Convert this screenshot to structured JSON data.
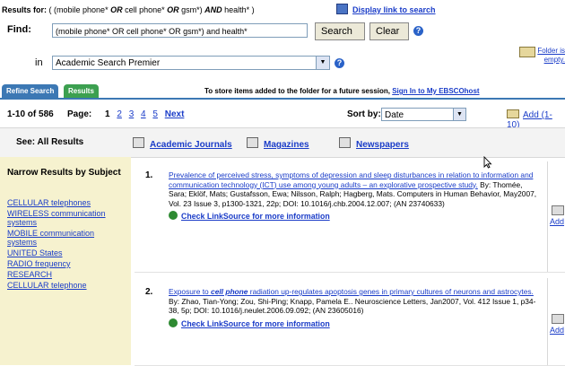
{
  "header": {
    "results_for_label": "Results for:",
    "results_for_query_a": "( (mobile phone* ",
    "results_for_op1": "OR",
    "results_for_query_b": " cell phone* ",
    "results_for_op2": "OR",
    "results_for_query_c": " gsm*) ",
    "results_for_op3": "AND",
    "results_for_query_d": " health* )",
    "display_link": "Display link to search"
  },
  "search": {
    "find_label": "Find:",
    "query_value": "(mobile phone* OR cell phone* OR gsm*) and health*",
    "search_button": "Search",
    "clear_button": "Clear",
    "in_label": "in",
    "database_value": "Academic Search Premier"
  },
  "folder": {
    "line1": "Folder is",
    "line2": "empty."
  },
  "tabs": {
    "refine": "Refine Search",
    "results": "Results",
    "store_prefix": "To store items added to the folder for a future session, ",
    "store_link": "Sign In to My EBSCOhost"
  },
  "pager": {
    "count": "1-10 of 586",
    "page_label": "Page:",
    "current_page": "1",
    "pages": [
      "2",
      "3",
      "4",
      "5"
    ],
    "next": "Next",
    "sort_label": "Sort by:",
    "sort_value": "Date",
    "add_range": "Add (1-10)"
  },
  "pubtypes": {
    "see_all": "See: All Results",
    "academic": "Academic Journals",
    "magazines": "Magazines",
    "newspapers": "Newspapers"
  },
  "narrow": {
    "heading": "Narrow Results by Subject",
    "items": [
      "CELLULAR telephones",
      "WIRELESS communication systems",
      "MOBILE communication systems",
      "UNITED States",
      "RADIO frequency",
      "RESEARCH",
      "CELLULAR telephone"
    ]
  },
  "results": [
    {
      "num": "1.",
      "title": "Prevalence of perceived stress, symptoms of depression and sleep disturbances in relation to information and communication technology (ICT) use among young adults – an explorative prospective study.",
      "details": " By: Thomée, Sara; Eklöf, Mats; Gustafsson, Ewa; Nilsson, Ralph; Hagberg, Mats. Computers in Human Behavior, May2007, Vol. 23 Issue 3, p1300-1321, 22p; DOI: 10.1016/j.chb.2004.12.007; (AN 23740633)",
      "linksource": "Check LinkSource for more information",
      "add": "Add"
    },
    {
      "num": "2.",
      "title_pre": "Exposure to ",
      "title_em": "cell phone",
      "title_post": " radiation up-regulates apoptosis genes in primary cultures of neurons and astrocytes.",
      "details": " By: Zhao, Tian-Yong; Zou, Shi-Ping; Knapp, Pamela E.. Neuroscience Letters, Jan2007, Vol. 412 Issue 1, p34-38, 5p; DOI: 10.1016/j.neulet.2006.09.092; (AN 23605016)",
      "linksource": "Check LinkSource for more information",
      "add": "Add"
    }
  ]
}
